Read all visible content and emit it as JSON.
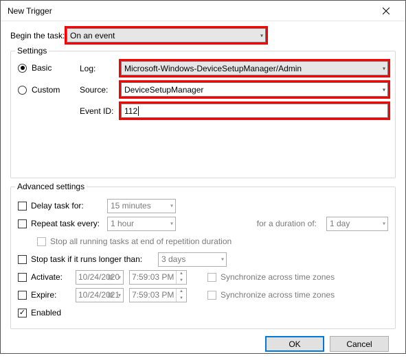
{
  "window": {
    "title": "New Trigger"
  },
  "begin": {
    "label": "Begin the task:",
    "value": "On an event"
  },
  "settings": {
    "legend": "Settings",
    "basic_label": "Basic",
    "custom_label": "Custom",
    "log_label": "Log:",
    "log_value": "Microsoft-Windows-DeviceSetupManager/Admin",
    "source_label": "Source:",
    "source_value": "DeviceSetupManager",
    "eventid_label": "Event ID:",
    "eventid_value": "112"
  },
  "advanced": {
    "legend": "Advanced settings",
    "delay_label": "Delay task for:",
    "delay_value": "15 minutes",
    "repeat_label": "Repeat task every:",
    "repeat_value": "1 hour",
    "duration_label": "for a duration of:",
    "duration_value": "1 day",
    "stop_running_label": "Stop all running tasks at end of repetition duration",
    "stop_longer_label": "Stop task if it runs longer than:",
    "stop_longer_value": "3 days",
    "activate_label": "Activate:",
    "activate_date": "10/24/2020",
    "activate_time": "7:59:03 PM",
    "expire_label": "Expire:",
    "expire_date": "10/24/2021",
    "expire_time": "7:59:03 PM",
    "sync_tz_label": "Synchronize across time zones",
    "enabled_label": "Enabled"
  },
  "buttons": {
    "ok": "OK",
    "cancel": "Cancel"
  }
}
